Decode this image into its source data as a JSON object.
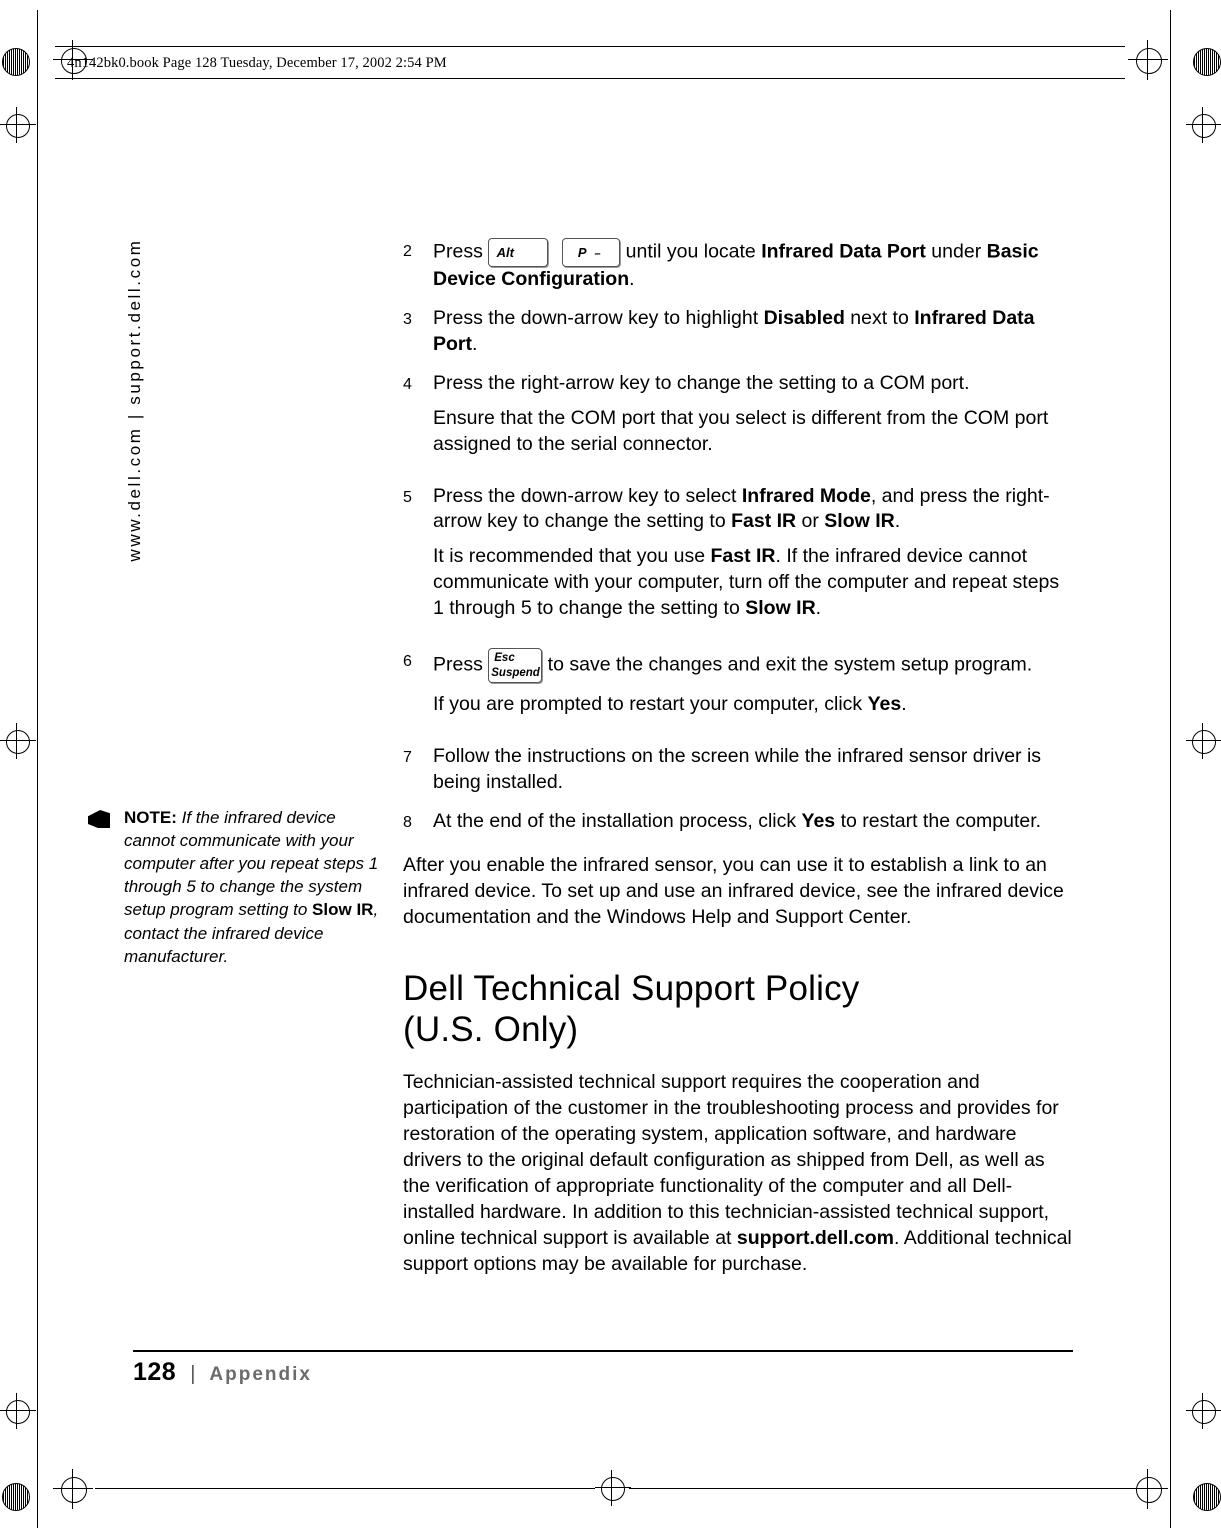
{
  "header": {
    "file_line": "4n142bk0.book  Page 128  Tuesday, December 17, 2002  2:54 PM"
  },
  "sidebar": {
    "vertical_text": "www.dell.com | support.dell.com"
  },
  "steps": [
    {
      "num": "2",
      "pre": "Press ",
      "key1": {
        "label": "Alt"
      },
      "key2": {
        "main": "P",
        "sub": "–"
      },
      "mid": " until you locate ",
      "b1": "Infrared Data Port",
      "mid2": " under ",
      "b2": "Basic Device Configuration",
      "end": "."
    },
    {
      "num": "3",
      "text_pre": "Press the down-arrow key to highlight ",
      "b1": "Disabled",
      "text_mid": " next to ",
      "b2": "Infrared Data Port",
      "text_end": "."
    },
    {
      "num": "4",
      "text": "Press the right-arrow key to change the setting to a COM port.",
      "sub": "Ensure that the COM port that you select is different from the COM port assigned to the serial connector."
    },
    {
      "num": "5",
      "text_pre": "Press the down-arrow key to select ",
      "b1": "Infrared Mode",
      "text_mid": ", and press the right-arrow key to change the setting to ",
      "b2": "Fast IR",
      "text_mid2": " or ",
      "b3": "Slow IR",
      "text_end": ".",
      "sub_pre": "It is recommended that you use ",
      "sub_b1": "Fast IR",
      "sub_mid": ". If the infrared device cannot communicate with your computer, turn off the computer and repeat steps 1 through 5 to change the setting to ",
      "sub_b2": "Slow IR",
      "sub_end": "."
    },
    {
      "num": "6",
      "pre": "Press ",
      "key": {
        "line1": "Esc",
        "line2": "Suspend"
      },
      "post": " to save the changes and exit the system setup program.",
      "sub_pre": "If you are prompted to restart your computer, click ",
      "sub_b": "Yes",
      "sub_end": "."
    },
    {
      "num": "7",
      "text": "Follow the instructions on the screen while the infrared sensor driver is being installed."
    },
    {
      "num": "8",
      "text_pre": "At the end of the installation process, click ",
      "b1": "Yes",
      "text_end": " to restart the computer."
    }
  ],
  "after_steps_paragraph": "After you enable the infrared sensor, you can use it to establish a link to an infrared device. To set up and use an infrared device, see the infrared device documentation and the Windows Help and Support Center.",
  "note": {
    "label": "NOTE:",
    "text_pre": " If the infrared device cannot communicate with your computer after you repeat steps 1 through 5 to change the system setup program setting to ",
    "bold": "Slow IR",
    "text_end": ", contact the infrared device manufacturer."
  },
  "heading": {
    "line1": "Dell Technical Support Policy",
    "line2": "(U.S. Only)"
  },
  "body_paragraph": {
    "pre": "Technician-assisted technical support requires the cooperation and participation of the customer in the troubleshooting process and provides for restoration of the operating system, application software, and hardware drivers to the original default configuration as shipped from Dell, as well as the verification of appropriate functionality of the computer and all Dell-installed hardware. In addition to this technician-assisted technical support, online technical support is available at ",
    "bold": "support.dell.com",
    "post": ". Additional technical support options may be available for purchase."
  },
  "footer": {
    "page_number": "128",
    "separator": "|",
    "section": "Appendix"
  }
}
